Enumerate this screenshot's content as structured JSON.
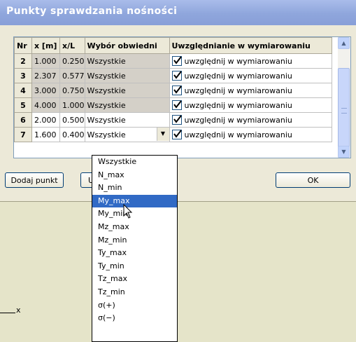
{
  "window": {
    "title": "Punkty sprawdzania nośności"
  },
  "grid": {
    "headers": [
      "Nr",
      "x [m]",
      "x/L",
      "Wybór obwiedni",
      "Uwzględnianie w wymiarowaniu"
    ],
    "rows": [
      {
        "nr": "2",
        "x": "1.000",
        "xl": "0.250",
        "obw": "Wszystkie",
        "uwz": "uwzględnij w wymiarowaniu"
      },
      {
        "nr": "3",
        "x": "2.307",
        "xl": "0.577",
        "obw": "Wszystkie",
        "uwz": "uwzględnij w wymiarowaniu"
      },
      {
        "nr": "4",
        "x": "3.000",
        "xl": "0.750",
        "obw": "Wszystkie",
        "uwz": "uwzględnij w wymiarowaniu"
      },
      {
        "nr": "5",
        "x": "4.000",
        "xl": "1.000",
        "obw": "Wszystkie",
        "uwz": "uwzględnij w wymiarowaniu"
      },
      {
        "nr": "6",
        "x": "2.000",
        "xl": "0.500",
        "obw": "Wszystkie",
        "uwz": "uwzględnij w wymiarowaniu"
      },
      {
        "nr": "7",
        "x": "1.600",
        "xl": "0.400",
        "obw": "Wszystkie",
        "uwz": "uwzględnij w wymiarowaniu"
      }
    ]
  },
  "buttons": {
    "add_point": "Dodaj punkt",
    "remove_partial": "U",
    "ok": "OK"
  },
  "dropdown": {
    "options": [
      "Wszystkie",
      "N_max",
      "N_min",
      "My_max",
      "My_min",
      "Mz_max",
      "Mz_min",
      "Ty_max",
      "Ty_min",
      "Tz_max",
      "Tz_min",
      "σ(+)",
      "σ(−)"
    ],
    "highlighted": "My_max"
  },
  "workspace": {
    "axis_label": "x"
  },
  "colors": {
    "selection": "#316ac5",
    "title_bar": "#8fa6dc",
    "workspace": "#e5e4c9"
  },
  "icons": {
    "check": "check-icon",
    "dropdown": "chevron-down-icon",
    "scroll_up": "scroll-up-icon",
    "scroll_down": "scroll-down-icon",
    "cursor": "mouse-cursor-icon"
  }
}
